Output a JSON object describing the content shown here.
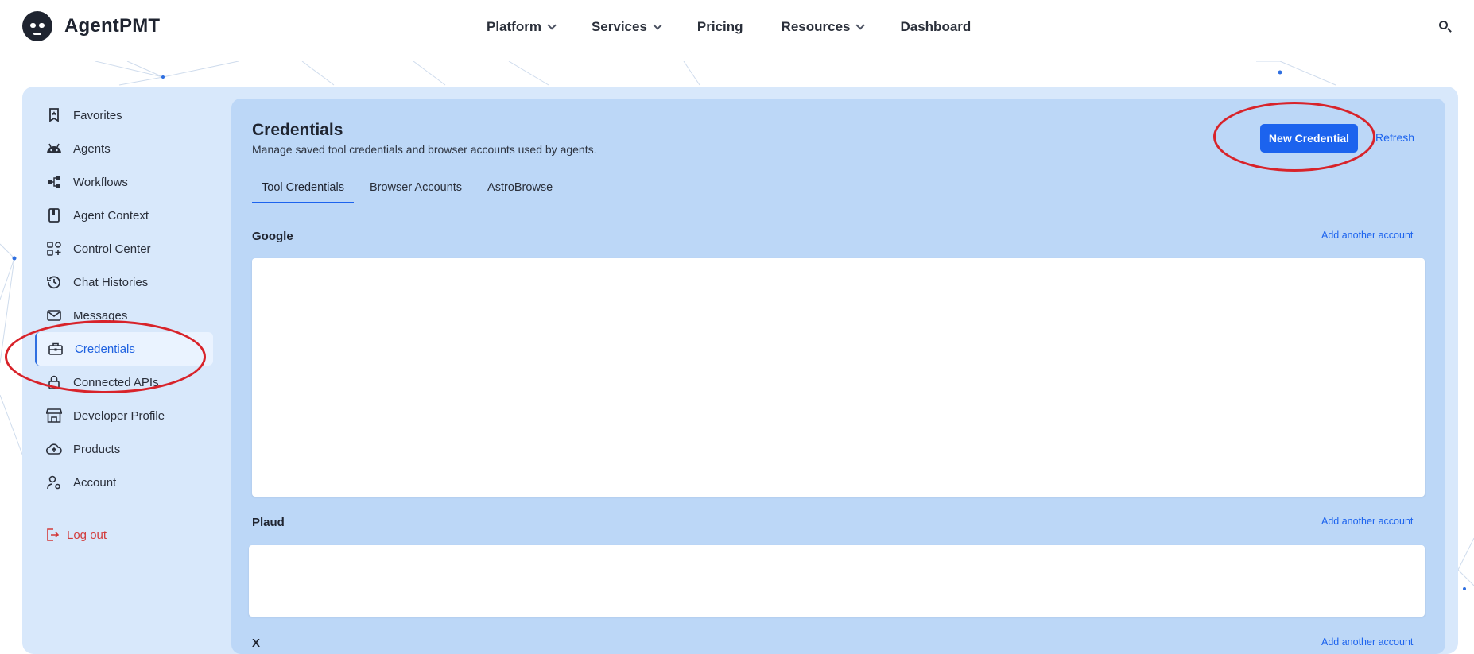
{
  "brand": {
    "name": "AgentPMT",
    "logo_icon": "robot-icon"
  },
  "nav": {
    "items": [
      {
        "label": "Platform",
        "has_dropdown": true
      },
      {
        "label": "Services",
        "has_dropdown": true
      },
      {
        "label": "Pricing",
        "has_dropdown": false
      },
      {
        "label": "Resources",
        "has_dropdown": true
      },
      {
        "label": "Dashboard",
        "has_dropdown": false
      }
    ],
    "search_icon": "search-icon"
  },
  "sidebar": {
    "items": [
      {
        "label": "Favorites",
        "icon": "bookmark-icon"
      },
      {
        "label": "Agents",
        "icon": "android-icon"
      },
      {
        "label": "Workflows",
        "icon": "workflow-icon"
      },
      {
        "label": "Agent Context",
        "icon": "book-icon"
      },
      {
        "label": "Control Center",
        "icon": "grid-plus-icon"
      },
      {
        "label": "Chat Histories",
        "icon": "history-icon"
      },
      {
        "label": "Messages",
        "icon": "mail-icon"
      },
      {
        "label": "Credentials",
        "icon": "briefcase-icon",
        "active": true
      },
      {
        "label": "Connected APIs",
        "icon": "lock-icon"
      },
      {
        "label": "Developer Profile",
        "icon": "store-icon"
      },
      {
        "label": "Products",
        "icon": "cloud-upload-icon"
      },
      {
        "label": "Account",
        "icon": "user-gear-icon"
      }
    ],
    "logout": {
      "label": "Log out",
      "icon": "logout-icon"
    }
  },
  "main": {
    "title": "Credentials",
    "subtitle": "Manage saved tool credentials and browser accounts used by agents.",
    "new_button": "New Credential",
    "refresh": "Refresh",
    "tabs": [
      {
        "label": "Tool Credentials",
        "active": true
      },
      {
        "label": "Browser Accounts",
        "active": false
      },
      {
        "label": "AstroBrowse",
        "active": false
      }
    ],
    "groups": [
      {
        "name": "Google",
        "add_label": "Add another account"
      },
      {
        "name": "Plaud",
        "add_label": "Add another account"
      },
      {
        "name": "X",
        "add_label": "Add another account"
      }
    ]
  },
  "colors": {
    "accent": "#1c63ee",
    "panel_bg": "#bcd7f7",
    "shell_bg": "#d8e8fb",
    "logout": "#d23b3b",
    "annotation": "#d8232a"
  }
}
